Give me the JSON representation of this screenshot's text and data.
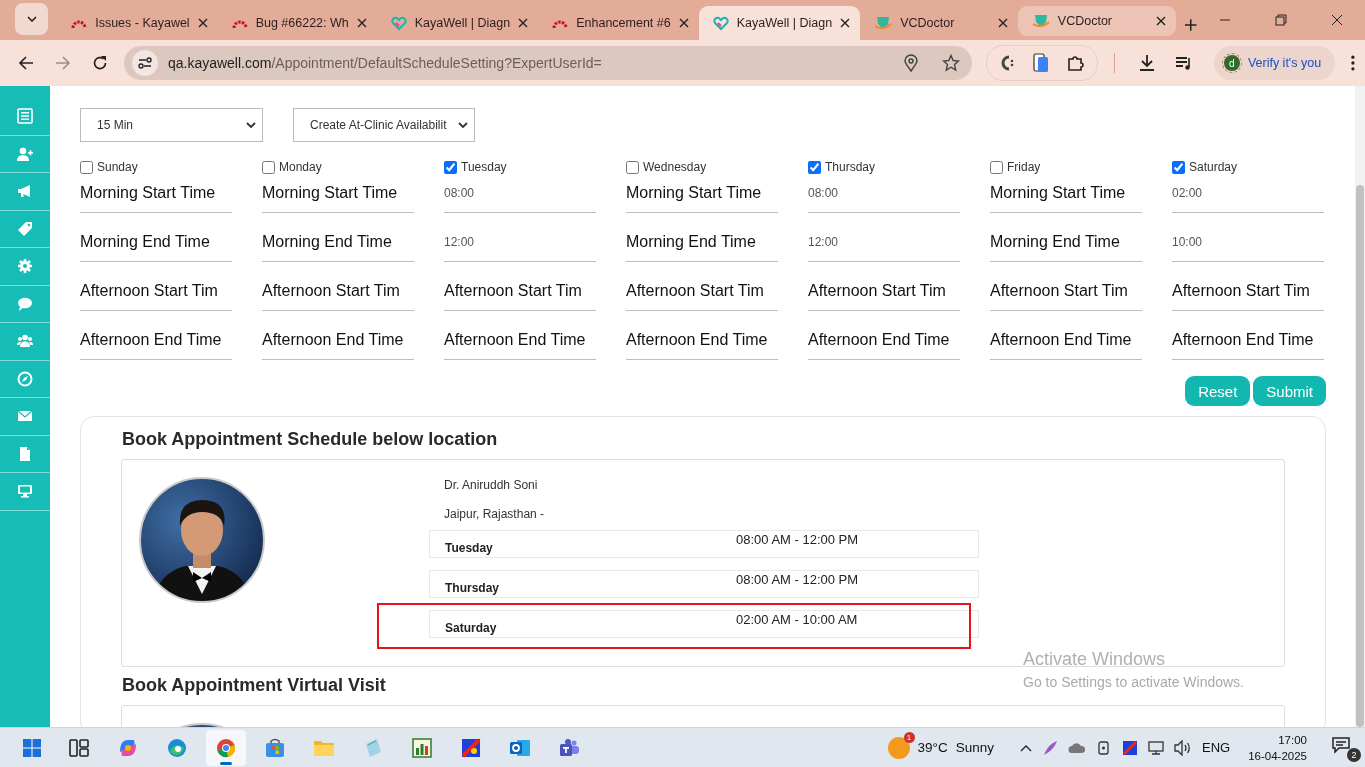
{
  "browser": {
    "tabs": [
      {
        "title": "Issues - Kayawel",
        "selected": false,
        "hovered": false
      },
      {
        "title": "Bug #66222: Wh",
        "selected": false,
        "hovered": false
      },
      {
        "title": "KayaWell | Diagn",
        "selected": false,
        "hovered": false
      },
      {
        "title": "Enhancement #6",
        "selected": false,
        "hovered": false
      },
      {
        "title": "KayaWell | Diagn",
        "selected": true,
        "hovered": false
      },
      {
        "title": "VCDoctor",
        "selected": false,
        "hovered": false
      },
      {
        "title": "VCDoctor",
        "selected": false,
        "hovered": true
      }
    ],
    "address": {
      "host": "qa.kayawell.com",
      "path": "/Appointment/DefaultScheduleSetting?ExpertUserId="
    },
    "profile": {
      "initial": "d",
      "label": "Verify it's you"
    }
  },
  "form": {
    "slot_select": "15 Min",
    "mode_select": "Create At-Clinic Availabilit",
    "days": [
      {
        "label": "Sunday",
        "checked": false,
        "fields": [
          {
            "placeholder": "Morning Start Time"
          },
          {
            "placeholder": "Morning End Time"
          },
          {
            "placeholder": "Afternoon Start Tim"
          },
          {
            "placeholder": "Afternoon End Time"
          }
        ]
      },
      {
        "label": "Monday",
        "checked": false,
        "fields": [
          {
            "placeholder": "Morning Start Time"
          },
          {
            "placeholder": "Morning End Time"
          },
          {
            "placeholder": "Afternoon Start Tim"
          },
          {
            "placeholder": "Afternoon End Time"
          }
        ]
      },
      {
        "label": "Tuesday",
        "checked": true,
        "fields": [
          {
            "value": "08:00"
          },
          {
            "value": "12:00"
          },
          {
            "placeholder": "Afternoon Start Tim"
          },
          {
            "placeholder": "Afternoon End Time"
          }
        ]
      },
      {
        "label": "Wednesday",
        "checked": false,
        "fields": [
          {
            "placeholder": "Morning Start Time"
          },
          {
            "placeholder": "Morning End Time"
          },
          {
            "placeholder": "Afternoon Start Tim"
          },
          {
            "placeholder": "Afternoon End Time"
          }
        ]
      },
      {
        "label": "Thursday",
        "checked": true,
        "fields": [
          {
            "value": "08:00"
          },
          {
            "value": "12:00"
          },
          {
            "placeholder": "Afternoon Start Tim"
          },
          {
            "placeholder": "Afternoon End Time"
          }
        ]
      },
      {
        "label": "Friday",
        "checked": false,
        "fields": [
          {
            "placeholder": "Morning Start Time"
          },
          {
            "placeholder": "Morning End Time"
          },
          {
            "placeholder": "Afternoon Start Tim"
          },
          {
            "placeholder": "Afternoon End Time"
          }
        ]
      },
      {
        "label": "Saturday",
        "checked": true,
        "fields": [
          {
            "value": "02:00"
          },
          {
            "value": "10:00"
          },
          {
            "placeholder": "Afternoon Start Tim"
          },
          {
            "placeholder": "Afternoon End Time"
          }
        ]
      }
    ],
    "buttons": [
      "Reset",
      "Submit"
    ]
  },
  "schedule": {
    "title": "Book Appointment Schedule below location",
    "doctor": {
      "name": "Dr. Aniruddh Soni",
      "location": "Jaipur, Rajasthan -"
    },
    "rows": [
      {
        "day": "Tuesday",
        "time": "08:00 AM - 12:00 PM",
        "highlighted": false
      },
      {
        "day": "Thursday",
        "time": "08:00 AM - 12:00 PM",
        "highlighted": false
      },
      {
        "day": "Saturday",
        "time": "02:00 AM - 10:00 AM",
        "highlighted": true
      }
    ]
  },
  "virtual": {
    "title": "Book Appointment Virtual Visit"
  },
  "activation_notice": {
    "title": "Activate Windows",
    "subtitle": "Go to Settings to activate Windows."
  },
  "taskbar": {
    "apps": [
      {
        "selected": false
      },
      {
        "selected": false
      },
      {
        "selected": false
      },
      {
        "selected": true
      },
      {
        "selected": false
      },
      {
        "selected": false
      },
      {
        "selected": false
      },
      {
        "selected": false
      },
      {
        "selected": false
      },
      {
        "selected": false
      },
      {
        "selected": false
      }
    ],
    "weather": {
      "badge": "1",
      "temp": "39°C",
      "condition": "Sunny"
    },
    "language": "ENG",
    "time": "17:00",
    "date": "16-04-2025",
    "notifications": "2"
  }
}
